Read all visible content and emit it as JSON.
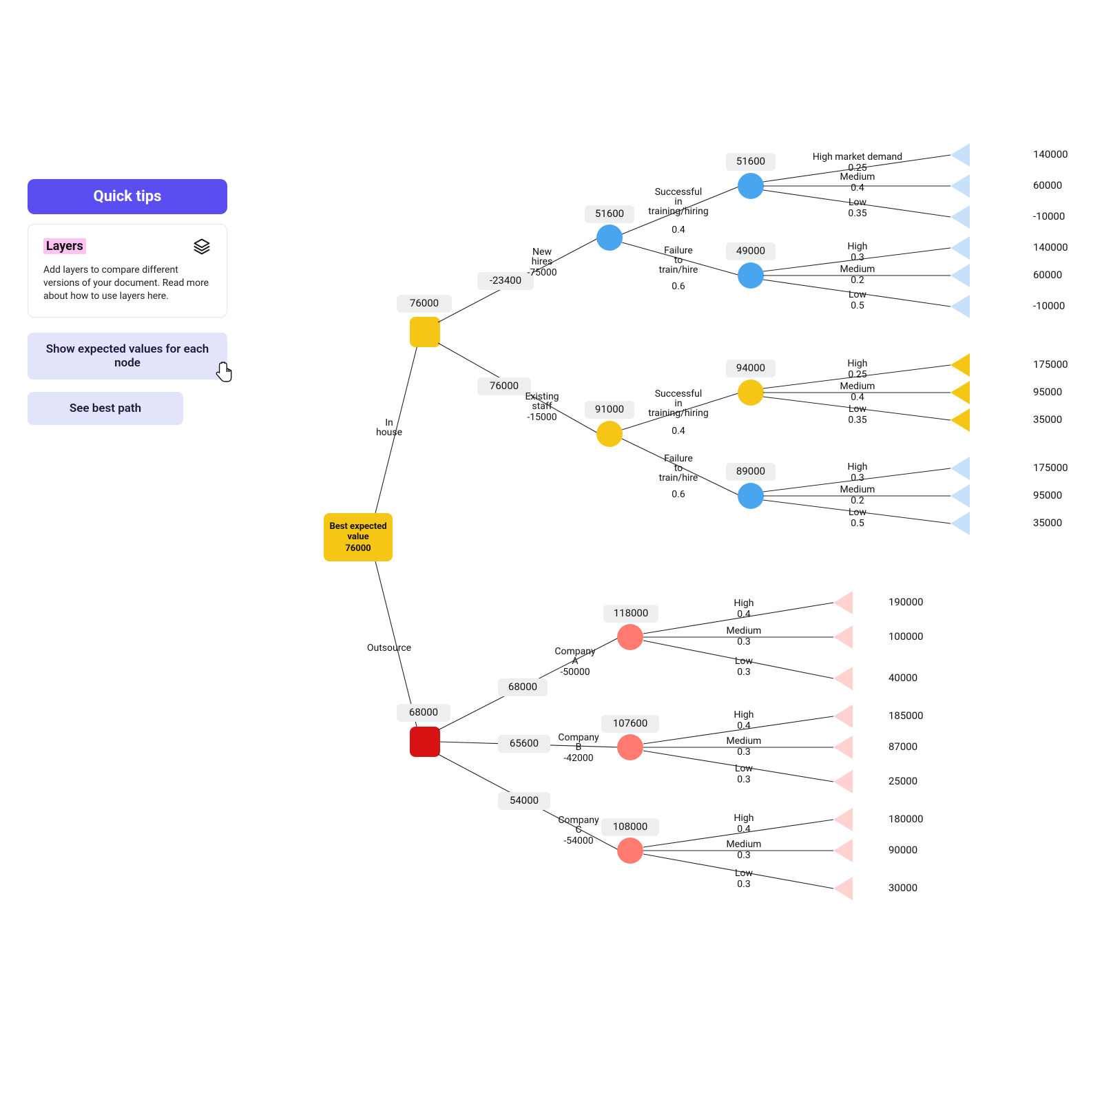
{
  "sidebar": {
    "quick_tips": "Quick tips",
    "layers_title": "Layers",
    "layers_body": "Add layers to compare different versions of your document. Read more about how to use layers here.",
    "btn_ev": "Show expected values for each node",
    "btn_best": "See best path"
  },
  "root": {
    "label_line1": "Best expected",
    "label_line2": "value",
    "value": "76000"
  },
  "branch_labels": {
    "inhouse": "In\nhouse",
    "outsource": "Outsource"
  },
  "inhouse": {
    "ev": "76000",
    "new_hires": {
      "ev": "-23400",
      "label": "New\nhires",
      "cost": "-75000",
      "ok": {
        "label": "Successful\nin\ntraining/hiring",
        "p": "0.4",
        "ev": "51600",
        "high": {
          "l": "High market demand",
          "p": "0.25",
          "v": "140000"
        },
        "med": {
          "l": "Medium",
          "p": "0.4",
          "v": "60000"
        },
        "low": {
          "l": "Low",
          "p": "0.35",
          "v": "-10000"
        }
      },
      "fail": {
        "label": "Failure\nto\ntrain/hire",
        "p": "0.6",
        "ev": "49000",
        "high": {
          "l": "High",
          "p": "0.3",
          "v": "140000"
        },
        "med": {
          "l": "Medium",
          "p": "0.2",
          "v": "60000"
        },
        "low": {
          "l": "Low",
          "p": "0.5",
          "v": "-10000"
        }
      }
    },
    "existing": {
      "ev": "76000",
      "label": "Existing\nstaff",
      "cost": "-15000",
      "chance_ev": "91000",
      "ok": {
        "label": "Successful\nin\ntraining/hiring",
        "p": "0.4",
        "ev": "94000",
        "high": {
          "l": "High",
          "p": "0.25",
          "v": "175000"
        },
        "med": {
          "l": "Medium",
          "p": "0.4",
          "v": "95000"
        },
        "low": {
          "l": "Low",
          "p": "0.35",
          "v": "35000"
        }
      },
      "fail": {
        "label": "Failure\nto\ntrain/hire",
        "p": "0.6",
        "ev": "89000",
        "high": {
          "l": "High",
          "p": "0.3",
          "v": "175000"
        },
        "med": {
          "l": "Medium",
          "p": "0.2",
          "v": "95000"
        },
        "low": {
          "l": "Low",
          "p": "0.5",
          "v": "35000"
        }
      }
    }
  },
  "outsource": {
    "ev": "68000",
    "a": {
      "label": "Company\nA",
      "cost": "-50000",
      "path_ev": "68000",
      "ev": "118000",
      "high": {
        "l": "High",
        "p": "0.4",
        "v": "190000"
      },
      "med": {
        "l": "Medium",
        "p": "0.3",
        "v": "100000"
      },
      "low": {
        "l": "Low",
        "p": "0.3",
        "v": "40000"
      }
    },
    "b": {
      "label": "Company\nB",
      "cost": "-42000",
      "path_ev": "65600",
      "ev": "107600",
      "high": {
        "l": "High",
        "p": "0.4",
        "v": "185000"
      },
      "med": {
        "l": "Medium",
        "p": "0.3",
        "v": "87000"
      },
      "low": {
        "l": "Low",
        "p": "0.3",
        "v": "25000"
      }
    },
    "c": {
      "label": "Company\nC",
      "cost": "-54000",
      "path_ev": "54000",
      "ev": "108000",
      "high": {
        "l": "High",
        "p": "0.4",
        "v": "180000"
      },
      "med": {
        "l": "Medium",
        "p": "0.3",
        "v": "90000"
      },
      "low": {
        "l": "Low",
        "p": "0.3",
        "v": "30000"
      }
    }
  }
}
